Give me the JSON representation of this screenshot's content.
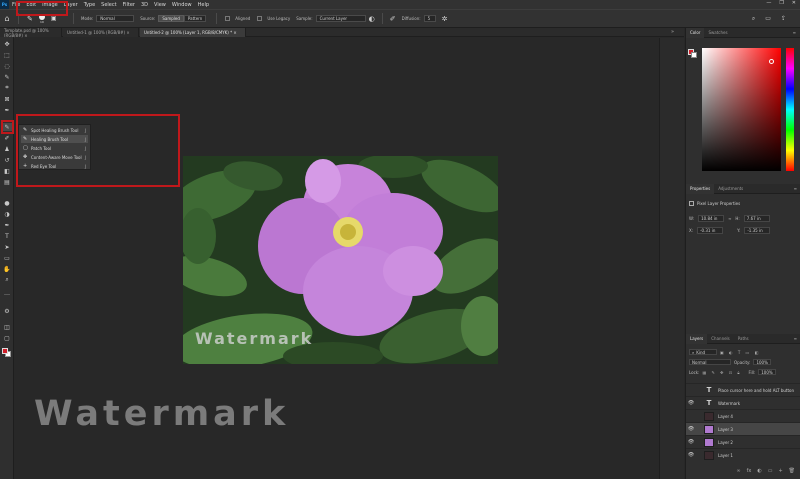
{
  "menubar": {
    "logo": "Ps",
    "items": [
      "File",
      "Edit",
      "Image",
      "Layer",
      "Type",
      "Select",
      "Filter",
      "3D",
      "View",
      "Window",
      "Help"
    ],
    "window_controls": [
      "—",
      "❐",
      "✕"
    ]
  },
  "options": {
    "brush_size": "19",
    "mode_label": "Mode:",
    "mode_value": "Normal",
    "source_label": "Source:",
    "source_sampled": "Sampled",
    "source_pattern": "Pattern",
    "aligned_label": "Aligned",
    "use_legacy_label": "Use Legacy",
    "sample_label": "Sample:",
    "sample_value": "Current Layer",
    "diffusion_label": "Diffusion:",
    "diffusion_value": "5"
  },
  "tabs": [
    "Template.psd @ 100% (RGB/8#) ×",
    "Untitled-1 @ 100% (RGB/8#) ×",
    "Untitled-2 @ 100% (Layer 1, RGB/8/CMYK) * ×"
  ],
  "flyout": {
    "items": [
      {
        "icon": "✎",
        "label": "Spot Healing Brush Tool",
        "key": "J",
        "active": false
      },
      {
        "icon": "✎",
        "label": "Healing Brush Tool",
        "key": "J",
        "active": true
      },
      {
        "icon": "▢",
        "label": "Patch Tool",
        "key": "J",
        "active": false
      },
      {
        "icon": "✥",
        "label": "Content-Aware Move Tool",
        "key": "J",
        "active": false
      },
      {
        "icon": "+",
        "label": "Red Eye Tool",
        "key": "J",
        "active": false
      }
    ]
  },
  "watermarks": {
    "small": "Watermark",
    "large": "Watermark"
  },
  "color_panel": {
    "tabs": [
      "Color",
      "Swatches"
    ],
    "foreground": "#d01f2a",
    "background": "#ffffff"
  },
  "properties": {
    "tabs": [
      "Properties",
      "Adjustments"
    ],
    "subtitle": "Pixel Layer Properties",
    "w_label": "W:",
    "w_value": "10.84 in",
    "h_label": "H:",
    "h_value": "7.67 in",
    "x_label": "X:",
    "x_value": "-0.31 in",
    "y_label": "Y:",
    "y_value": "-1.35 in"
  },
  "layers_panel": {
    "tabs": [
      "Layers",
      "Channels",
      "Paths"
    ],
    "kind": "Kind",
    "blend": "Normal",
    "opacity_label": "Opacity:",
    "opacity_value": "100%",
    "lock_label": "Lock:",
    "fill_label": "Fill:",
    "fill_value": "100%",
    "layers": [
      {
        "name": "Place cursor here and hold ALT button",
        "type": "text",
        "visible": false,
        "active": false
      },
      {
        "name": "Watermark",
        "type": "text",
        "visible": true,
        "active": false
      },
      {
        "name": "Layer 4",
        "type": "image",
        "visible": false,
        "active": false
      },
      {
        "name": "Layer 3",
        "type": "image",
        "visible": true,
        "active": true
      },
      {
        "name": "Layer 2",
        "type": "image",
        "visible": true,
        "active": false
      },
      {
        "name": "Layer 1",
        "type": "image",
        "visible": true,
        "active": false
      }
    ]
  },
  "colors": {
    "highlight_red": "#c0181b",
    "petal_pink": "#c27ed8",
    "leaf_green": "#3e6a34",
    "panel_bg": "#2f2f2f"
  }
}
